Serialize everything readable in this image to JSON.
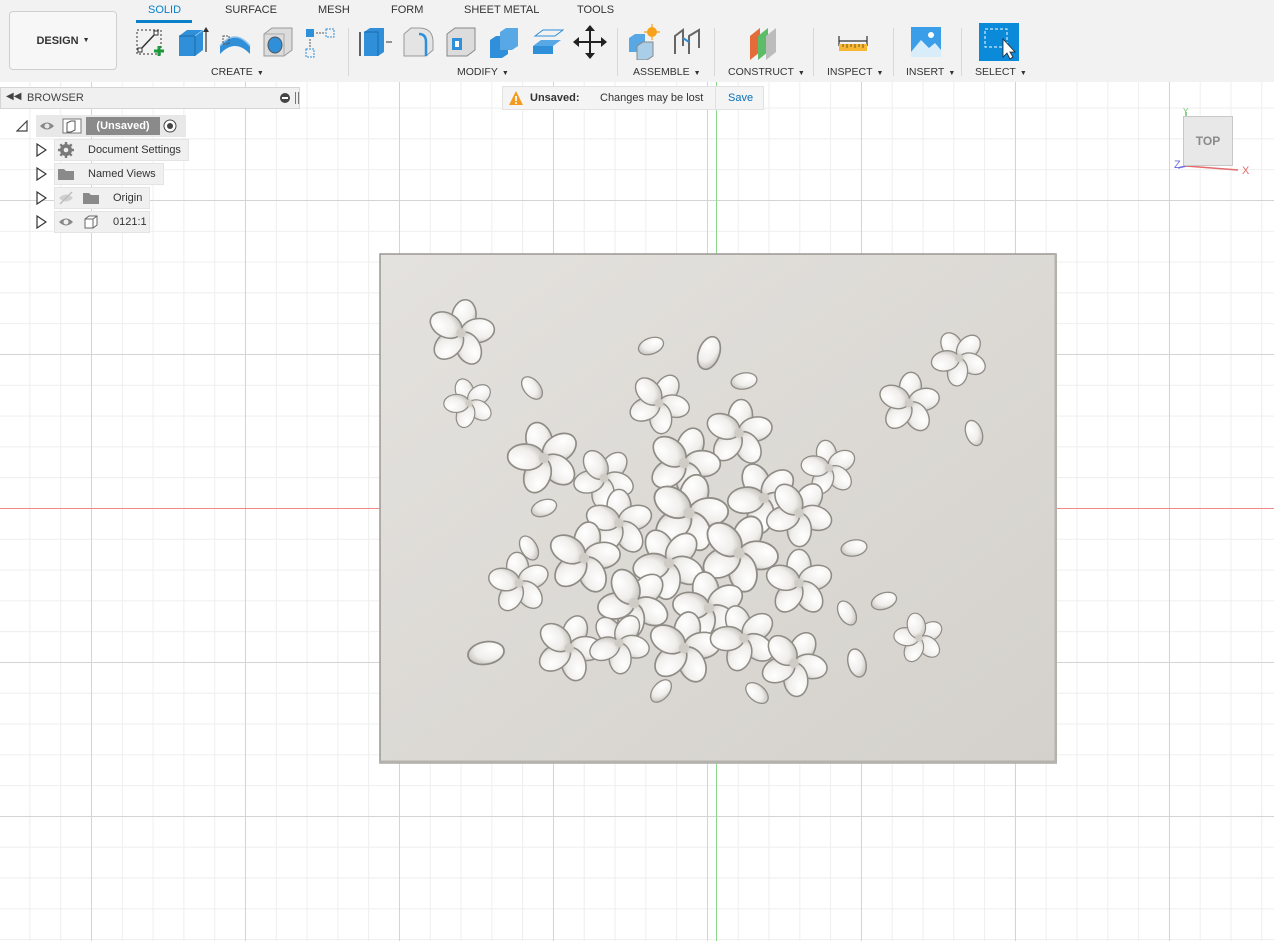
{
  "workspace": {
    "label": "DESIGN"
  },
  "tabs": [
    {
      "label": "SOLID",
      "active": true
    },
    {
      "label": "SURFACE"
    },
    {
      "label": "MESH"
    },
    {
      "label": "FORM"
    },
    {
      "label": "SHEET METAL"
    },
    {
      "label": "TOOLS"
    }
  ],
  "groups": {
    "create": "CREATE",
    "modify": "MODIFY",
    "assemble": "ASSEMBLE",
    "construct": "CONSTRUCT",
    "inspect": "INSPECT",
    "insert": "INSERT",
    "select": "SELECT"
  },
  "browser": {
    "title": "BROWSER",
    "root_label": "(Unsaved)",
    "items": [
      {
        "label": "Document Settings",
        "icon": "gear-icon"
      },
      {
        "label": "Named Views",
        "icon": "folder-icon"
      },
      {
        "label": "Origin",
        "icon": "folder-icon"
      },
      {
        "label": "0121:1",
        "icon": "body-icon"
      }
    ]
  },
  "banner": {
    "title": "Unsaved:",
    "message": "Changes may be lost",
    "action": "Save"
  },
  "viewcube": {
    "face": "TOP",
    "axis_x": "X",
    "axis_z": "Z",
    "axis_y": "Y"
  },
  "colors": {
    "accent": "#0a80c8",
    "axis_x": "#f08a8a",
    "axis_y": "#8ad88a",
    "model": "#d9d6d2"
  }
}
